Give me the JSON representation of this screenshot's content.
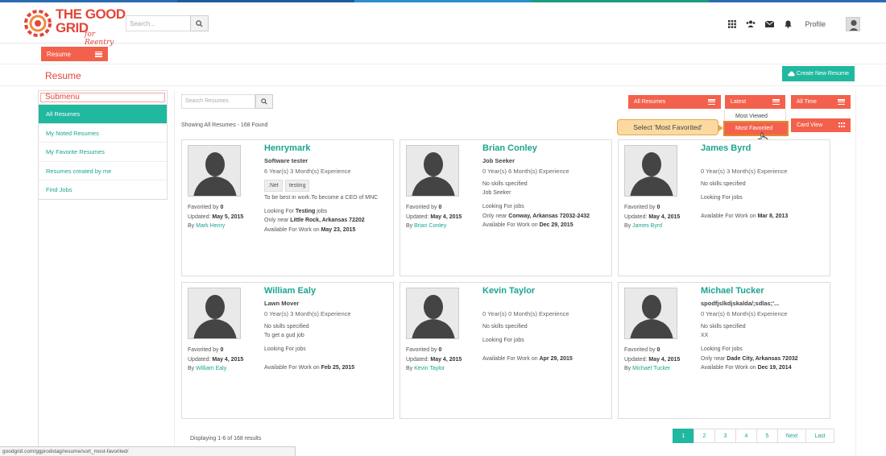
{
  "brand": {
    "logo_line1": "THE GOOD",
    "logo_line2": "GRID",
    "logo_sub": "for Reentry",
    "accent": "#f3614c",
    "teal": "#21b8a0"
  },
  "header": {
    "search_placeholder": "Search...",
    "profile_label": "Profile"
  },
  "subnav": {
    "resume_tab": "Resume"
  },
  "page": {
    "title": "Resume",
    "create_button": "Create New Resume"
  },
  "sidebar": {
    "title": "Submenu",
    "items": [
      {
        "label": "All Resumes",
        "active": true
      },
      {
        "label": "My Noted Resumes"
      },
      {
        "label": "My Favorite Resumes"
      },
      {
        "label": "Resumes created by me"
      },
      {
        "label": "Find Jobs"
      }
    ]
  },
  "toolbar": {
    "search_placeholder": "Search Resumes",
    "filter_all": "All Resumes",
    "filter_sort": "Latest",
    "filter_time": "All Time",
    "view": "Card View",
    "showing": "Showing All Resumes - 168 Found"
  },
  "dropdown": {
    "items": [
      "Most Viewed",
      "Most Favorited"
    ]
  },
  "callout": "Select 'Most Favorited'",
  "cards": [
    {
      "name": "Henrymark",
      "role": "Software tester",
      "exp": "6 Year(s) 3 Month(s) Experience",
      "tags": [
        ".Net",
        "testing"
      ],
      "summary": "To be best in work.To become a CEO of MNC",
      "looking_pre": "Looking For ",
      "looking_bold": "Testing",
      "looking_post": " jobs",
      "near_pre": "Only near ",
      "near_bold": "Little Rock, Arkansas 72202",
      "avail_pre": "Available For Work on ",
      "avail_bold": "May 23, 2015",
      "fav_label": "Favorited by ",
      "fav": "0",
      "upd_label": "Updated: ",
      "updated": "May 5, 2015",
      "by_label": "By ",
      "by": "Mark Henry"
    },
    {
      "name": "Brian Conley",
      "role": "Job Seeker",
      "exp": "0 Year(s) 6 Month(s) Experience",
      "skills": "No skills specified",
      "summary": "Job Seeker",
      "looking": "Looking For jobs",
      "near_pre": "Only near ",
      "near_bold": "Conway, Arkansas 72032-2432",
      "avail_pre": "Available For Work on ",
      "avail_bold": "Dec 29, 2015",
      "fav_label": "Favorited by ",
      "fav": "0",
      "upd_label": "Updated: ",
      "updated": "May 4, 2015",
      "by_label": "By ",
      "by": "Brian Conley"
    },
    {
      "name": "James Byrd",
      "exp": "0 Year(s) 3 Month(s) Experience",
      "skills": "No skills specified",
      "looking": "Looking For jobs",
      "avail_pre": "Available For Work on ",
      "avail_bold": "Mar 8, 2013",
      "fav_label": "Favorited by ",
      "fav": "0",
      "upd_label": "Updated: ",
      "updated": "May 4, 2015",
      "by_label": "By ",
      "by": "James Byrd"
    },
    {
      "name": "William Ealy",
      "role": "Lawn Mover",
      "exp": "0 Year(s) 3 Month(s) Experience",
      "skills": "No skills specified",
      "summary": "To get a gud job",
      "looking": "Looking For jobs",
      "avail_pre": "Available For Work on ",
      "avail_bold": "Feb 25, 2015",
      "fav_label": "Favorited by ",
      "fav": "0",
      "upd_label": "Updated: ",
      "updated": "May 4, 2015",
      "by_label": "By ",
      "by": "William Ealy"
    },
    {
      "name": "Kevin Taylor",
      "exp": "0 Year(s) 0 Month(s) Experience",
      "skills": "No skills specified",
      "looking": "Looking For jobs",
      "avail_pre": "Available For Work on ",
      "avail_bold": "Apr 29, 2015",
      "fav_label": "Favorited by ",
      "fav": "0",
      "upd_label": "Updated: ",
      "updated": "May 4, 2015",
      "by_label": "By ",
      "by": "Kevin Taylor"
    },
    {
      "name": "Michael Tucker",
      "role": "spodfjslkdjskalda/;sdlas;'...",
      "exp": "0 Year(s) 6 Month(s) Experience",
      "skills": "No skills specified",
      "summary": "XX",
      "looking": "Looking For jobs",
      "near_pre": "Only near ",
      "near_bold": "Dade City, Arkansas 72032",
      "avail_pre": "Available For Work on ",
      "avail_bold": "Dec 19, 2014",
      "fav_label": "Favorited by ",
      "fav": "0",
      "upd_label": "Updated: ",
      "updated": "May 4, 2015",
      "by_label": "By ",
      "by": "Michael Tucker"
    }
  ],
  "footer": {
    "displaying": "Displaying 1-6 of 168 results",
    "pages": [
      "1",
      "2",
      "3",
      "4",
      "5",
      "Next",
      "Last"
    ],
    "status_url": "goodgrid.com/ggprodstag/resume/sort_most-favorited/"
  }
}
